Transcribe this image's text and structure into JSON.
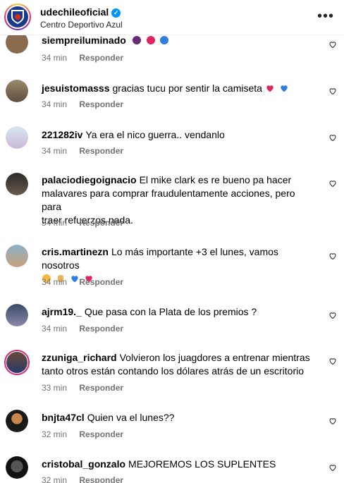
{
  "header": {
    "account_name": "udechileoficial",
    "subtitle": "Centro Deportivo Azul",
    "verified_icon": "verified-badge-icon",
    "more_icon": "more-options-icon"
  },
  "reply_label": "Responder",
  "comments": [
    {
      "user": "siempreiluminado",
      "text": "",
      "time": "34 min"
    },
    {
      "user": "jesuistomasss",
      "text": "gracias tucu por sentir la camiseta",
      "time": "34 min"
    },
    {
      "user": "221282iv",
      "text": "Ya era el nico guerra.. vendanlo",
      "time": "34 min"
    },
    {
      "user": "palaciodiegoignacio",
      "text": "El mike clark es re bueno pa hacer",
      "text2": "malavares para comprar fraudulentamente acciones, pero para",
      "text3": "traer refuerzos nada.",
      "time": "34 min"
    },
    {
      "user": "cris.martinezn",
      "text": "Lo más importante +3 el lunes, vamos nosotros",
      "time": "34 min"
    },
    {
      "user": "ajrm19._",
      "text": "Que pasa con la Plata de los premios ?",
      "time": "34 min"
    },
    {
      "user": "zzuniga_richard",
      "text": "Volvieron los juagdores a entrenar mientras",
      "text2": "tanto otros están contando los dólares atrás de un escritorio",
      "time": "33 min"
    },
    {
      "user": "bnjta47cl",
      "text": "Quien va el lunes??",
      "time": "32 min"
    },
    {
      "user": "cristobal_gonzalo",
      "text": "MEJOREMOS LOS SUPLENTES",
      "time": "32 min"
    }
  ],
  "colors": {
    "accent": "#0095f6",
    "secondary_text": "#737373",
    "heart_red": "#ed4956",
    "heart_blue": "#2f7ee0"
  }
}
